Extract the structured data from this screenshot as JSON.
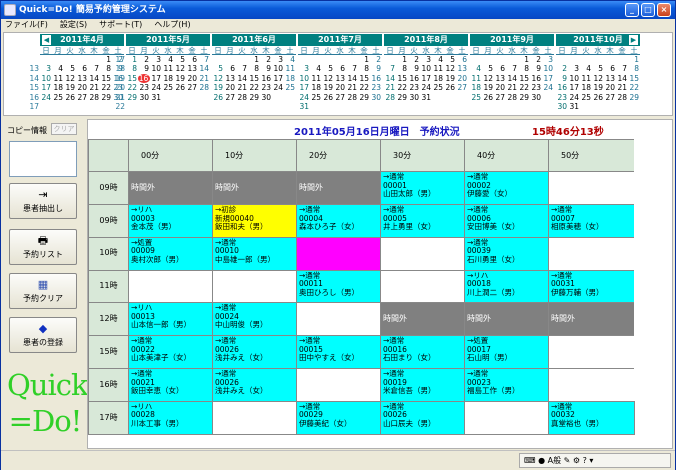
{
  "window": {
    "title": "Quick=Do!  簡易予約管理システム"
  },
  "menu": [
    "ファイル(F)",
    "設定(S)",
    "サポート(T)",
    "ヘルプ(H)"
  ],
  "calendar": {
    "dow": [
      "日",
      "月",
      "火",
      "水",
      "木",
      "金",
      "土"
    ],
    "months": [
      {
        "label": "2011年4月",
        "weeks": [
          [
            "",
            "",
            "",
            "",
            "",
            "1",
            "2"
          ],
          [
            "3",
            "4",
            "5",
            "6",
            "7",
            "8",
            "9"
          ],
          [
            "10",
            "11",
            "12",
            "13",
            "14",
            "15",
            "16"
          ],
          [
            "17",
            "18",
            "19",
            "20",
            "21",
            "22",
            "23"
          ],
          [
            "24",
            "25",
            "26",
            "27",
            "28",
            "29",
            "30"
          ],
          [
            "",
            "",
            "",
            "",
            "",
            "",
            ""
          ]
        ],
        "weeknums": [
          "",
          "13",
          "14",
          "15",
          "16",
          "17"
        ]
      },
      {
        "label": "2011年5月",
        "weeks": [
          [
            "1",
            "2",
            "3",
            "4",
            "5",
            "6",
            "7"
          ],
          [
            "8",
            "9",
            "10",
            "11",
            "12",
            "13",
            "14"
          ],
          [
            "15",
            "16",
            "17",
            "18",
            "19",
            "20",
            "21"
          ],
          [
            "22",
            "23",
            "24",
            "25",
            "26",
            "27",
            "28"
          ],
          [
            "29",
            "30",
            "31",
            "",
            "",
            "",
            ""
          ],
          [
            "",
            "",
            "",
            "",
            "",
            "",
            ""
          ]
        ],
        "weeknums": [
          "17",
          "18",
          "19",
          "20",
          "21",
          "22"
        ]
      },
      {
        "label": "2011年6月",
        "weeks": [
          [
            "",
            "",
            "",
            "1",
            "2",
            "3",
            "4"
          ],
          [
            "5",
            "6",
            "7",
            "8",
            "9",
            "10",
            "11"
          ],
          [
            "12",
            "13",
            "14",
            "15",
            "16",
            "17",
            "18"
          ],
          [
            "19",
            "20",
            "21",
            "22",
            "23",
            "24",
            "25"
          ],
          [
            "26",
            "27",
            "28",
            "29",
            "30",
            "",
            ""
          ],
          [
            "",
            "",
            "",
            "",
            "",
            "",
            ""
          ]
        ],
        "weeknums": []
      },
      {
        "label": "2011年7月",
        "weeks": [
          [
            "",
            "",
            "",
            "",
            "",
            "1",
            "2"
          ],
          [
            "3",
            "4",
            "5",
            "6",
            "7",
            "8",
            "9"
          ],
          [
            "10",
            "11",
            "12",
            "13",
            "14",
            "15",
            "16"
          ],
          [
            "17",
            "18",
            "19",
            "20",
            "21",
            "22",
            "23"
          ],
          [
            "24",
            "25",
            "26",
            "27",
            "28",
            "29",
            "30"
          ],
          [
            "31",
            "",
            "",
            "",
            "",
            "",
            ""
          ]
        ],
        "weeknums": []
      },
      {
        "label": "2011年8月",
        "weeks": [
          [
            "",
            "1",
            "2",
            "3",
            "4",
            "5",
            "6"
          ],
          [
            "7",
            "8",
            "9",
            "10",
            "11",
            "12",
            "13"
          ],
          [
            "14",
            "15",
            "16",
            "17",
            "18",
            "19",
            "20"
          ],
          [
            "21",
            "22",
            "23",
            "24",
            "25",
            "26",
            "27"
          ],
          [
            "28",
            "29",
            "30",
            "31",
            "",
            "",
            ""
          ],
          [
            "",
            "",
            "",
            "",
            "",
            "",
            ""
          ]
        ],
        "weeknums": []
      },
      {
        "label": "2011年9月",
        "weeks": [
          [
            "",
            "",
            "",
            "",
            "1",
            "2",
            "3"
          ],
          [
            "4",
            "5",
            "6",
            "7",
            "8",
            "9",
            "10"
          ],
          [
            "11",
            "12",
            "13",
            "14",
            "15",
            "16",
            "17"
          ],
          [
            "18",
            "19",
            "20",
            "21",
            "22",
            "23",
            "24"
          ],
          [
            "25",
            "26",
            "27",
            "28",
            "29",
            "30",
            ""
          ],
          [
            "",
            "",
            "",
            "",
            "",
            "",
            ""
          ]
        ],
        "weeknums": []
      },
      {
        "label": "2011年10月",
        "weeks": [
          [
            "",
            "",
            "",
            "",
            "",
            "",
            "1"
          ],
          [
            "2",
            "3",
            "4",
            "5",
            "6",
            "7",
            "8"
          ],
          [
            "9",
            "10",
            "11",
            "12",
            "13",
            "14",
            "15"
          ],
          [
            "16",
            "17",
            "18",
            "19",
            "20",
            "21",
            "22"
          ],
          [
            "23",
            "24",
            "25",
            "26",
            "27",
            "28",
            "29"
          ],
          [
            "30",
            "31",
            "",
            "",
            "",
            "",
            ""
          ]
        ],
        "weeknums": []
      }
    ],
    "today": "2011年5月16日",
    "nav_prev": "◀",
    "nav_next": "▶"
  },
  "left": {
    "copy_label": "コピー情報",
    "clear_button": "クリア",
    "buttons": [
      {
        "label": "患者抽出し",
        "icon": "⇥"
      },
      {
        "label": "予約リスト",
        "icon": "🖶"
      },
      {
        "label": "予約クリア",
        "icon": "▦"
      },
      {
        "label": "患者の登録",
        "icon": "◆"
      }
    ],
    "logo_line1": "Quick",
    "logo_line2": "=Do!"
  },
  "header": {
    "title": "2011年05月16日月曜日　予約状況",
    "clock": "15時46分13秒"
  },
  "grid": {
    "columns": [
      "00分",
      "10分",
      "20分",
      "30分",
      "40分",
      "50分"
    ],
    "rows": [
      {
        "hour": "09時",
        "cells": [
          {
            "style": "gray",
            "lines": [
              "時間外"
            ]
          },
          {
            "style": "gray",
            "lines": [
              "時間外"
            ]
          },
          {
            "style": "gray",
            "lines": [
              "時間外"
            ]
          },
          {
            "style": "cyan",
            "lines": [
              "→通常",
              "00001",
              "山田太郎（男）"
            ]
          },
          {
            "style": "cyan",
            "lines": [
              "→通常",
              "00002",
              "伊藤愛（女）"
            ]
          },
          {
            "style": "white",
            "lines": []
          }
        ]
      },
      {
        "hour": "09時",
        "cells": [
          {
            "style": "cyan",
            "lines": [
              "→リハ",
              "00003",
              "金本茂（男）"
            ]
          },
          {
            "style": "yellow",
            "lines": [
              "→初診",
              "新規00040",
              "飯田和夫（男）"
            ]
          },
          {
            "style": "cyan",
            "lines": [
              "→通常",
              "00004",
              "森本ひろ子（女）"
            ]
          },
          {
            "style": "cyan",
            "lines": [
              "→通常",
              "00005",
              "井上勇里（女）"
            ]
          },
          {
            "style": "cyan",
            "lines": [
              "→通常",
              "00006",
              "安田博美（女）"
            ]
          },
          {
            "style": "cyan",
            "lines": [
              "→通常",
              "00007",
              "相原美穂（女）"
            ]
          }
        ]
      },
      {
        "hour": "10時",
        "cells": [
          {
            "style": "cyan",
            "lines": [
              "→処置",
              "00009",
              "奥村次郎（男）"
            ]
          },
          {
            "style": "cyan",
            "lines": [
              "→通常",
              "00010",
              "中島雄一郎（男）"
            ]
          },
          {
            "style": "mag",
            "lines": []
          },
          {
            "style": "white",
            "lines": []
          },
          {
            "style": "cyan",
            "lines": [
              "→通常",
              "00039",
              "石川勇里（女）"
            ]
          },
          {
            "style": "white",
            "lines": []
          }
        ]
      },
      {
        "hour": "11時",
        "cells": [
          {
            "style": "white",
            "lines": []
          },
          {
            "style": "white",
            "lines": []
          },
          {
            "style": "cyan",
            "lines": [
              "→通常",
              "00011",
              "奥田ひろし（男）"
            ]
          },
          {
            "style": "white",
            "lines": []
          },
          {
            "style": "cyan",
            "lines": [
              "→リハ",
              "00018",
              "川上潤二（男）"
            ]
          },
          {
            "style": "cyan",
            "lines": [
              "→通常",
              "00031",
              "伊藤万輔（男）"
            ]
          }
        ]
      },
      {
        "hour": "12時",
        "cells": [
          {
            "style": "cyan",
            "lines": [
              "→リハ",
              "00013",
              "山本信一郎（男）"
            ]
          },
          {
            "style": "cyan",
            "lines": [
              "→通常",
              "00024",
              "中山明俊（男）"
            ]
          },
          {
            "style": "white",
            "lines": []
          },
          {
            "style": "gray",
            "lines": [
              "時間外"
            ]
          },
          {
            "style": "gray",
            "lines": [
              "時間外"
            ]
          },
          {
            "style": "gray",
            "lines": [
              "時間外"
            ]
          }
        ]
      },
      {
        "hour": "15時",
        "cells": [
          {
            "style": "cyan",
            "lines": [
              "→通常",
              "00022",
              "山本美津子（女）"
            ]
          },
          {
            "style": "cyan",
            "lines": [
              "→通常",
              "00026",
              "浅井みえ（女）"
            ]
          },
          {
            "style": "cyan",
            "lines": [
              "→通常",
              "00015",
              "田中やすえ（女）"
            ]
          },
          {
            "style": "cyan",
            "lines": [
              "→通常",
              "00016",
              "石田まり（女）"
            ]
          },
          {
            "style": "cyan",
            "lines": [
              "→処置",
              "00017",
              "石山明（男）"
            ]
          },
          {
            "style": "white",
            "lines": []
          }
        ]
      },
      {
        "hour": "16時",
        "cells": [
          {
            "style": "cyan",
            "lines": [
              "→通常",
              "00021",
              "飯田幸恵（女）"
            ]
          },
          {
            "style": "cyan",
            "lines": [
              "→通常",
              "00026",
              "浅井みえ（女）"
            ]
          },
          {
            "style": "white",
            "lines": []
          },
          {
            "style": "cyan",
            "lines": [
              "→通常",
              "00019",
              "米倉信吾（男）"
            ]
          },
          {
            "style": "cyan",
            "lines": [
              "→通常",
              "00023",
              "福島工作（男）"
            ]
          },
          {
            "style": "white",
            "lines": []
          }
        ]
      },
      {
        "hour": "17時",
        "cells": [
          {
            "style": "cyan",
            "lines": [
              "→リハ",
              "00028",
              "川本工事（男）"
            ]
          },
          {
            "style": "white",
            "lines": []
          },
          {
            "style": "cyan",
            "lines": [
              "→通常",
              "00029",
              "伊藤美紀（女）"
            ]
          },
          {
            "style": "cyan",
            "lines": [
              "→通常",
              "00026",
              "山口辰夫（男）"
            ]
          },
          {
            "style": "white",
            "lines": []
          },
          {
            "style": "cyan",
            "lines": [
              "→通常",
              "00032",
              "真堂裕也（男）"
            ]
          }
        ]
      }
    ]
  },
  "statusbar": {
    "tray_text": "A般"
  }
}
